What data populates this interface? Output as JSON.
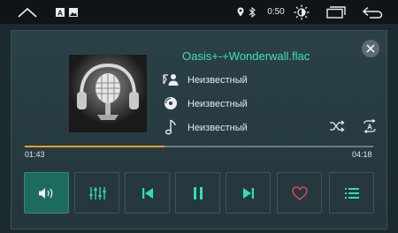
{
  "statusbar": {
    "time": "0:50",
    "icons": [
      "home-icon",
      "app-a-icon",
      "image-icon",
      "location-icon",
      "bluetooth-icon",
      "brightness-icon",
      "recent-apps-icon",
      "back-icon"
    ]
  },
  "player": {
    "title": "Oasis+-+Wonderwall.flac",
    "artist": "Неизвестный",
    "album": "Неизвестный",
    "genre": "Неизвестный",
    "elapsed": "01:43",
    "duration": "04:18",
    "progress_fraction": 0.4
  },
  "controls": [
    "volume-icon",
    "equalizer-icon",
    "previous-icon",
    "pause-icon",
    "next-icon",
    "favorite-icon",
    "playlist-icon"
  ],
  "colors": {
    "accent": "#3fe0c0",
    "progress": "#f39a2a",
    "favorite": "#e0455a",
    "active_button": "#1d6b60"
  }
}
